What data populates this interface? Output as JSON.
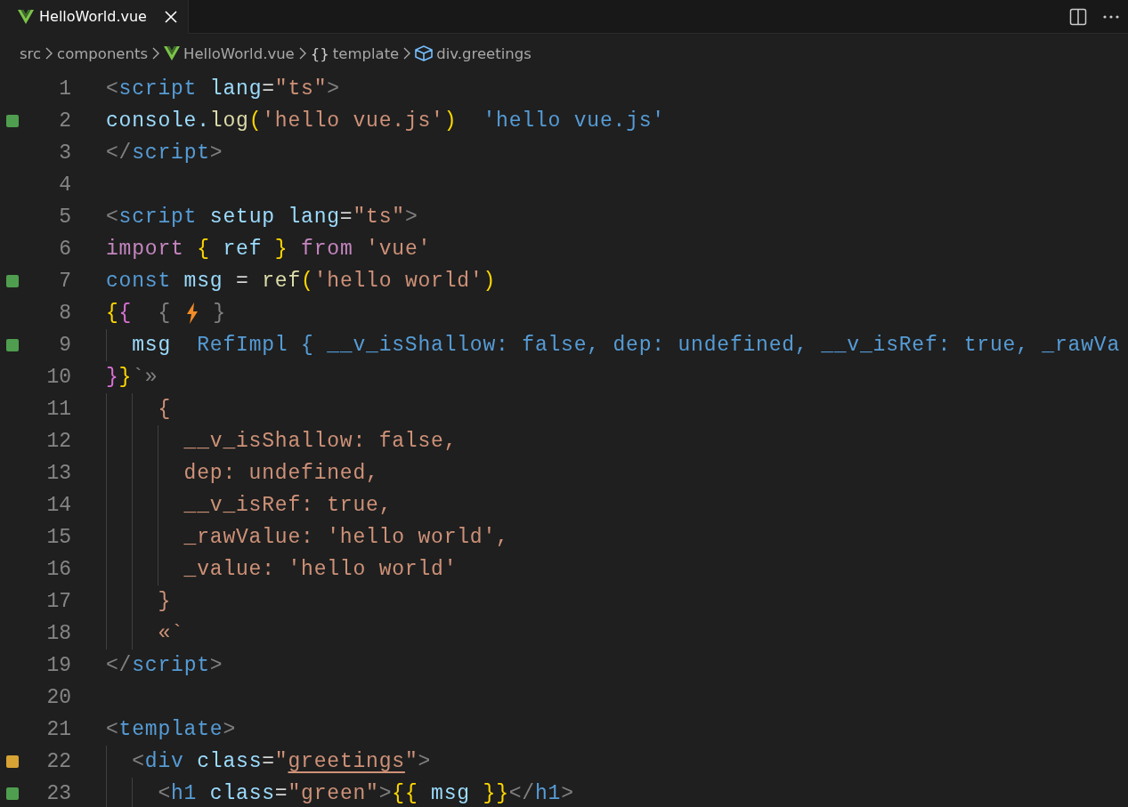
{
  "tabs": [
    {
      "title": "HelloWorld.vue",
      "kind": "vue",
      "selected": true
    }
  ],
  "breadcrumbs": [
    {
      "label": "src",
      "kind": "folder"
    },
    {
      "label": "components",
      "kind": "folder"
    },
    {
      "label": "HelloWorld.vue",
      "kind": "vue"
    },
    {
      "label": "template",
      "kind": "symbol",
      "symbol": "{}"
    },
    {
      "label": "div.greetings",
      "kind": "cube"
    }
  ],
  "lines": [
    {
      "number": "1",
      "tokens": [
        {
          "t": "<",
          "kind": "punct"
        },
        {
          "t": "script",
          "kind": "tag"
        },
        {
          "t": " lang",
          "kind": "attr"
        },
        {
          "t": "=",
          "kind": "plain"
        },
        {
          "t": "\"ts\"",
          "kind": "str"
        },
        {
          "t": ">",
          "kind": "punct"
        }
      ]
    },
    {
      "number": "2",
      "color": "#4f9e4f",
      "tokens": [
        {
          "t": "console.",
          "kind": "var"
        },
        {
          "t": "log",
          "kind": "fn"
        },
        {
          "t": "(",
          "kind": "br1"
        },
        {
          "t": "'hello vue.js'",
          "kind": "str"
        },
        {
          "t": ")",
          "kind": "br1"
        },
        {
          "t": "  'hello vue.js'",
          "kind": "inlay"
        }
      ]
    },
    {
      "number": "3",
      "tokens": [
        {
          "t": "</",
          "kind": "punct"
        },
        {
          "t": "script",
          "kind": "tag"
        },
        {
          "t": ">",
          "kind": "punct"
        }
      ]
    },
    {
      "number": "4"
    },
    {
      "number": "5",
      "tokens": [
        {
          "t": "<",
          "kind": "punct"
        },
        {
          "t": "script",
          "kind": "tag"
        },
        {
          "t": " setup lang",
          "kind": "attr"
        },
        {
          "t": "=",
          "kind": "plain"
        },
        {
          "t": "\"ts\"",
          "kind": "str"
        },
        {
          "t": ">",
          "kind": "punct"
        }
      ]
    },
    {
      "number": "6",
      "tokens": [
        {
          "t": "import",
          "kind": "kw"
        },
        {
          "t": " {",
          "kind": "br1"
        },
        {
          "t": " ref",
          "kind": "var"
        },
        {
          "t": " }",
          "kind": "br1"
        },
        {
          "t": " from",
          "kind": "kw"
        },
        {
          "t": " 'vue'",
          "kind": "str"
        }
      ]
    },
    {
      "number": "7",
      "color": "#4f9e4f",
      "tokens": [
        {
          "t": "const",
          "kind": "tag"
        },
        {
          "t": " msg",
          "kind": "var"
        },
        {
          "t": " = ",
          "kind": "plain"
        },
        {
          "t": "ref",
          "kind": "fn"
        },
        {
          "t": "(",
          "kind": "br1"
        },
        {
          "t": "'hello world'",
          "kind": "str"
        },
        {
          "t": ")",
          "kind": "br1"
        }
      ]
    },
    {
      "number": "8",
      "tokens": [
        {
          "t": "{",
          "kind": "br1"
        },
        {
          "t": "{",
          "kind": "br2"
        },
        {
          "t": "  { ",
          "kind": "punct"
        },
        {
          "kind": "bolt"
        },
        {
          "t": " }",
          "kind": "punct"
        }
      ]
    },
    {
      "number": "9",
      "color": "#4f9e4f",
      "tokens": [
        {
          "t": "  msg",
          "kind": "inlayvar"
        },
        {
          "t": "  RefImpl { __v_isShallow: false, dep: undefined, __v_isRef: true, _rawVa",
          "kind": "inlay"
        }
      ]
    },
    {
      "number": "10",
      "tokens": [
        {
          "t": "}",
          "kind": "br2"
        },
        {
          "t": "}",
          "kind": "br1"
        },
        {
          "t": "`»",
          "kind": "punct"
        }
      ]
    },
    {
      "number": "11",
      "tokens": [
        {
          "t": "    {",
          "kind": "str"
        }
      ]
    },
    {
      "number": "12",
      "tokens": [
        {
          "t": "      __v_isShallow: false,",
          "kind": "str"
        }
      ]
    },
    {
      "number": "13",
      "tokens": [
        {
          "t": "      dep: undefined,",
          "kind": "str"
        }
      ]
    },
    {
      "number": "14",
      "tokens": [
        {
          "t": "      __v_isRef: true,",
          "kind": "str"
        }
      ]
    },
    {
      "number": "15",
      "tokens": [
        {
          "t": "      _rawValue: 'hello world',",
          "kind": "str"
        }
      ]
    },
    {
      "number": "16",
      "tokens": [
        {
          "t": "      _value: 'hello world'",
          "kind": "str"
        }
      ]
    },
    {
      "number": "17",
      "tokens": [
        {
          "t": "    }",
          "kind": "str"
        }
      ]
    },
    {
      "number": "18",
      "tokens": [
        {
          "t": "    «`",
          "kind": "str"
        }
      ]
    },
    {
      "number": "19",
      "tokens": [
        {
          "t": "</",
          "kind": "punct"
        },
        {
          "t": "script",
          "kind": "tag"
        },
        {
          "t": ">",
          "kind": "punct"
        }
      ]
    },
    {
      "number": "20"
    },
    {
      "number": "21",
      "tokens": [
        {
          "t": "<",
          "kind": "punct"
        },
        {
          "t": "template",
          "kind": "tag"
        },
        {
          "t": ">",
          "kind": "punct"
        }
      ]
    },
    {
      "number": "22",
      "color": "#d7a335",
      "tokens": [
        {
          "t": "  <",
          "kind": "punct"
        },
        {
          "t": "div",
          "kind": "tag"
        },
        {
          "t": " class",
          "kind": "attr"
        },
        {
          "t": "=",
          "kind": "plain"
        },
        {
          "t": "\"",
          "kind": "str"
        },
        {
          "t": "greetings",
          "kind": "strline"
        },
        {
          "t": "\"",
          "kind": "str"
        },
        {
          "t": ">",
          "kind": "punct"
        }
      ]
    },
    {
      "number": "23",
      "color": "#4f9e4f",
      "tokens": [
        {
          "t": "    <",
          "kind": "punct"
        },
        {
          "t": "h1",
          "kind": "tag"
        },
        {
          "t": " class",
          "kind": "attr"
        },
        {
          "t": "=",
          "kind": "plain"
        },
        {
          "t": "\"green\"",
          "kind": "str"
        },
        {
          "t": ">",
          "kind": "punct"
        },
        {
          "t": "{{",
          "kind": "br1"
        },
        {
          "t": " msg ",
          "kind": "var"
        },
        {
          "t": "}}",
          "kind": "br1"
        },
        {
          "t": "</",
          "kind": "punct"
        },
        {
          "t": "h1",
          "kind": "tag"
        },
        {
          "t": ">",
          "kind": "punct"
        }
      ]
    }
  ]
}
